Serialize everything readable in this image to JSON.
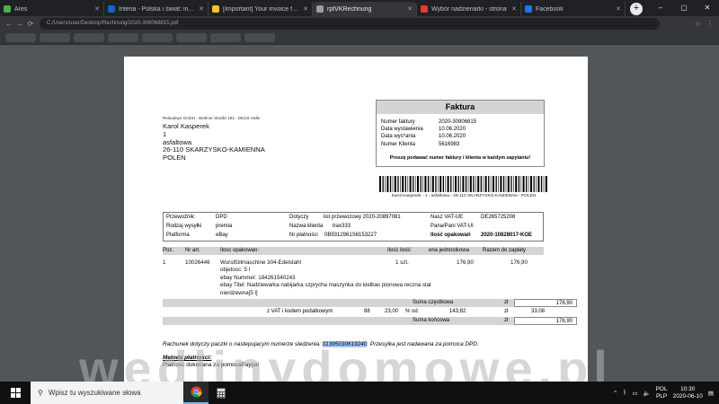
{
  "browser": {
    "tabs": [
      {
        "title": "Ares",
        "fav": "#4caf50",
        "active": false
      },
      {
        "title": "Interia - Polska i świat: informacje",
        "fav": "#1565c0",
        "active": false
      },
      {
        "title": "[Important] Your invoice from",
        "fav": "#fbc02d",
        "active": false
      },
      {
        "title": "rptVKRechnung",
        "fav": "#9e9e9e",
        "active": true
      },
      {
        "title": "Wybór nadzienarki - strona",
        "fav": "#e53935",
        "active": false
      },
      {
        "title": "Facebook",
        "fav": "#1877f2",
        "active": false
      }
    ],
    "new_tab": "+",
    "url": "C:/Users/user/Desktop/Rechnung/2020-309068815.pdf",
    "window_controls": {
      "minimize": "–",
      "maximize": "▢",
      "close": "✕"
    }
  },
  "invoice": {
    "sender_line": "Relaxdays GmbH - Berliner Straße 191 - 08116 Halle",
    "recipient": {
      "name": "Karol Kasperek",
      "line2": "1",
      "street": "asfaltowa",
      "city": "26-110 SKARZYSKO-KAMIENNA",
      "country": "POLEN"
    },
    "header_title": "Faktura",
    "meta": [
      {
        "label": "Numer faktury",
        "value": "2020-30906815"
      },
      {
        "label": "Data wystawienia",
        "value": "10.06.2020"
      },
      {
        "label": "Data wys*ania",
        "value": "10.06.2020"
      },
      {
        "label": "Numer Klienta",
        "value": "5616983"
      }
    ],
    "meta_note": "Proszę podawać numer faktury i klienta w każdym zapytaniu!",
    "barcode_caption": "Karol Kasperek - 1 - asfaltowa - 26-110 SKARZYSKO-KAMIENNA - POLEN",
    "shipping": {
      "carrier_label": "Przewoźnik:",
      "carrier_value": "DPD",
      "ship_type_label": "Rodzaj wysyłki",
      "ship_type_value": "premia",
      "platform_label": "Platforma",
      "platform_value": "eBay",
      "docs_label": "Dotyczy",
      "docs_value": "list przewozowy 2020-20897081",
      "client_name_label": "Nazwa klienta",
      "client_name_value": "trax333",
      "payment_no_label": "Nr płatności",
      "payment_no_value": "0B9312961S6153227",
      "vat_label": "Nasz VAT-UE",
      "vat_value": "DE265725208",
      "vat2_label": "Pana/Pani VAT-UI",
      "vat2_value": "",
      "order_label": "Ilość opakowań",
      "order_value": "2020-10828017-KOE"
    },
    "items_header": {
      "pos": "Poz.",
      "art": "Nr art.",
      "desc": "Ilosc opakowan:",
      "qty": "Ilość ilość",
      "unit_price": "ena jednostkowa",
      "total": "Razem do zapłaty"
    },
    "item": {
      "pos": "1",
      "art": "10026446",
      "name": "Wurstfüllmaschine 304-Edelstahl",
      "volume": "objetosc: 5 l",
      "ebay_no": "ebay Nummer: 184261540243",
      "ebay_title": "ebay Titel: Nadziewarka nabijarka szprycha maszynka do kielbas pionowa reczna stal",
      "ebay_title2": "nierdzewna[5 l]",
      "qty": "1 szt.",
      "unit_price": "176,90",
      "total": "176,90"
    },
    "subtotal": {
      "label": "Suma częstkowa",
      "currency": "zł",
      "value": "176,90"
    },
    "vat_row": {
      "label": "z VAT i kodem podatkowym",
      "code": "88",
      "rate": "23,00",
      "pct": "% od",
      "base": "143,82",
      "currency": "zł",
      "value": "33,08"
    },
    "total": {
      "label": "Suma końcowa",
      "currency": "zł",
      "value": "176,90"
    },
    "note_prefix": "Rachunek dotyczy paczki o nastepujacym numerze sledzenia: ",
    "tracking": "01395030619240",
    "note_suffix": ". Przesylka jest nadawana za pomoca DPD.",
    "method_title": "Metoda płatności:",
    "method_text": "Platnosc dokonana za pomocaPaypal"
  },
  "watermark": "wedlinydomowe.pl",
  "taskbar": {
    "search_placeholder": "Wpisz tu wyszukiwane słowa",
    "lang_top": "POL",
    "lang_bottom": "PLP",
    "time": "10:30",
    "date": "2020-06-10"
  }
}
